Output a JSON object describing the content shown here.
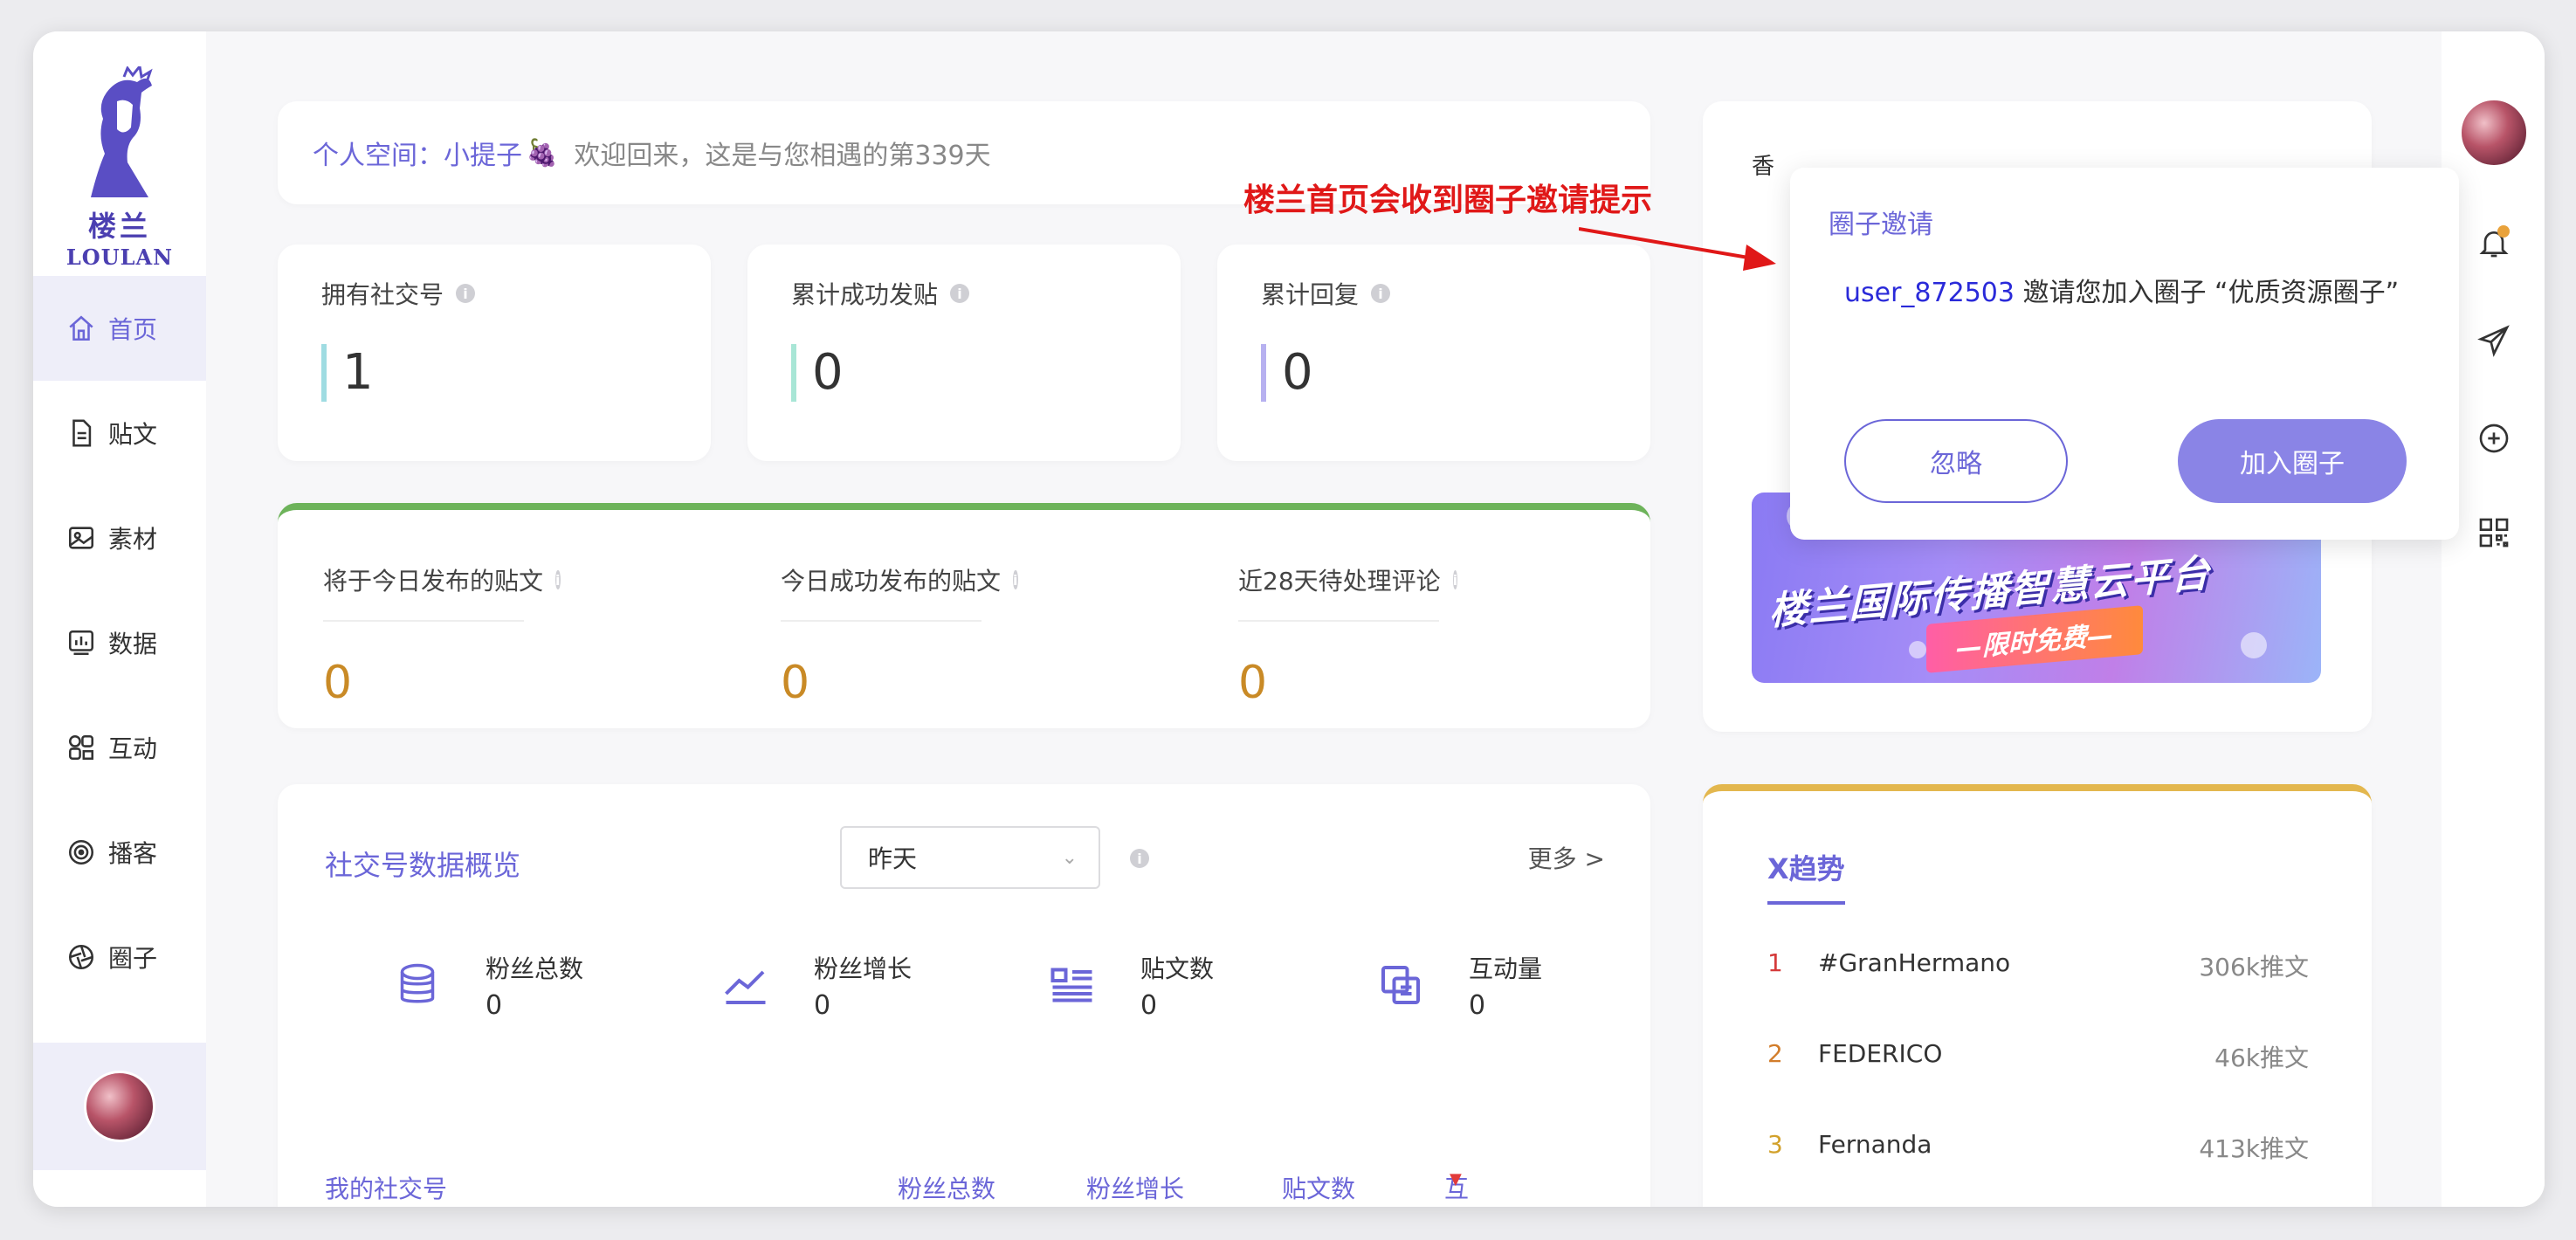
{
  "sidebar": {
    "logo": {
      "cn": "楼兰",
      "en": "LOULAN"
    },
    "items": [
      {
        "label": "首页",
        "icon": "home-icon",
        "active": true
      },
      {
        "label": "贴文",
        "icon": "document-icon"
      },
      {
        "label": "素材",
        "icon": "image-icon"
      },
      {
        "label": "数据",
        "icon": "chart-icon"
      },
      {
        "label": "互动",
        "icon": "interaction-icon"
      },
      {
        "label": "播客",
        "icon": "podcast-icon"
      },
      {
        "label": "圈子",
        "icon": "circle-group-icon"
      }
    ]
  },
  "welcome": {
    "space_label": "个人空间：小提子",
    "emoji": "🍇",
    "message": "欢迎回来，这是与您相遇的第339天"
  },
  "stats": [
    {
      "label": "拥有社交号",
      "value": "1",
      "accent": "#9fdce2"
    },
    {
      "label": "累计成功发贴",
      "value": "0",
      "accent": "#a8e6d6"
    },
    {
      "label": "累计回复",
      "value": "0",
      "accent": "#b7b1f0"
    }
  ],
  "publish": [
    {
      "label": "将于今日发布的贴文",
      "value": "0"
    },
    {
      "label": "今日成功发布的贴文",
      "value": "0"
    },
    {
      "label": "近28天待处理评论",
      "value": "0"
    }
  ],
  "overview": {
    "title": "社交号数据概览",
    "select_value": "昨天",
    "more": "更多 >",
    "metrics": [
      {
        "label": "粉丝总数",
        "value": "0",
        "icon": "database-icon"
      },
      {
        "label": "粉丝增长",
        "value": "0",
        "icon": "trend-line-icon"
      },
      {
        "label": "贴文数",
        "value": "0",
        "icon": "post-list-icon"
      },
      {
        "label": "互动量",
        "value": "0",
        "icon": "interaction-count-icon"
      }
    ],
    "table_headers": [
      "我的社交号",
      "粉丝总数",
      "粉丝增长",
      "贴文数",
      "互动量"
    ]
  },
  "banner": {
    "tab_partial": "香",
    "title": "楼兰国际传播智慧云平台",
    "subtitle": "—限时免费—"
  },
  "trends": {
    "title": "X趋势",
    "items": [
      {
        "rank": "1",
        "tag": "#GranHermano",
        "count": "306k推文",
        "color": "#d53b3b"
      },
      {
        "rank": "2",
        "tag": "FEDERICO",
        "count": "46k推文",
        "color": "#d27d2b"
      },
      {
        "rank": "3",
        "tag": "Fernanda",
        "count": "413k推文",
        "color": "#d2a12b"
      }
    ]
  },
  "popup": {
    "title": "圈子邀请",
    "user": "user_872503",
    "message": " 邀请您加入圈子 “优质资源圈子”",
    "ignore": "忽略",
    "join": "加入圈子"
  },
  "annotation": "楼兰首页会收到圈子邀请提示"
}
